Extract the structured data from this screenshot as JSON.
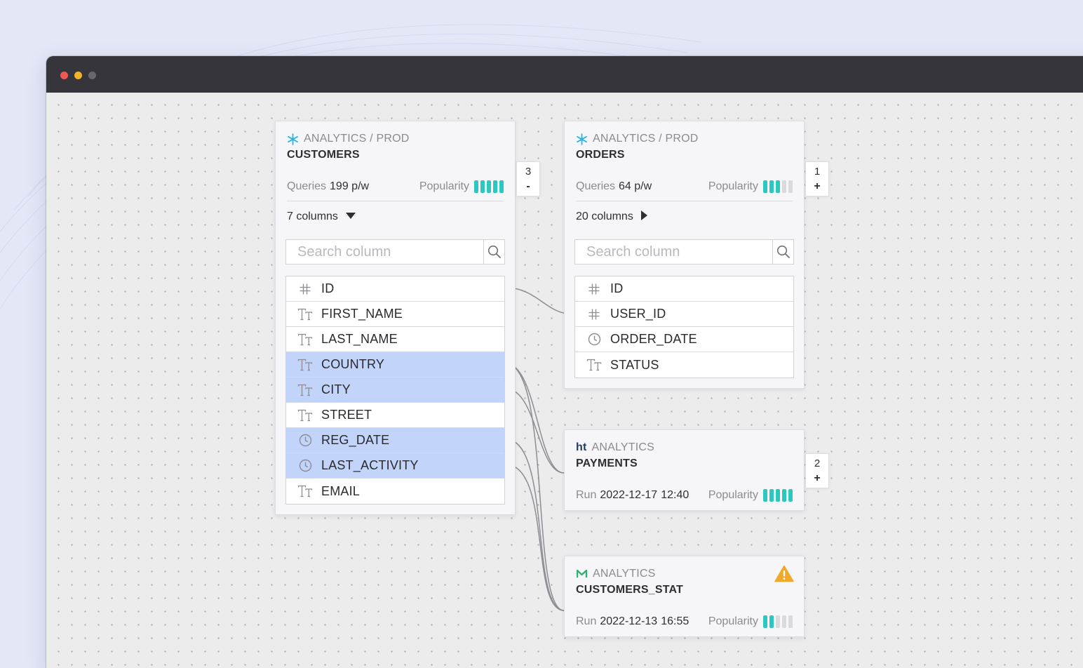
{
  "colors": {
    "accent": "#2cc8c0",
    "selected_row": "#c2d4f9",
    "titlebar": "#36353b",
    "warning": "#f0a92b"
  },
  "customers": {
    "crumb": "ANALYTICS / PROD",
    "icon": "snowflake-icon",
    "name": "CUSTOMERS",
    "queries_label": "Queries",
    "queries_value": "199 p/w",
    "popularity_label": "Popularity",
    "popularity": 5,
    "columns_label": "7 columns",
    "columns_expanded": true,
    "search_placeholder": "Search column",
    "badge_count": "3",
    "badge_toggle": "-",
    "columns": [
      {
        "name": "ID",
        "type": "hash-icon",
        "selected": false
      },
      {
        "name": "FIRST_NAME",
        "type": "text-type-icon",
        "selected": false
      },
      {
        "name": "LAST_NAME",
        "type": "text-type-icon",
        "selected": false
      },
      {
        "name": "COUNTRY",
        "type": "text-type-icon",
        "selected": true
      },
      {
        "name": "CITY",
        "type": "text-type-icon",
        "selected": true
      },
      {
        "name": "STREET",
        "type": "text-type-icon",
        "selected": false
      },
      {
        "name": "REG_DATE",
        "type": "clock-icon",
        "selected": true
      },
      {
        "name": "LAST_ACTIVITY",
        "type": "clock-icon",
        "selected": true
      },
      {
        "name": "EMAIL",
        "type": "text-type-icon",
        "selected": false
      }
    ]
  },
  "orders": {
    "crumb": "ANALYTICS / PROD",
    "icon": "snowflake-icon",
    "name": "ORDERS",
    "queries_label": "Queries",
    "queries_value": "64 p/w",
    "popularity_label": "Popularity",
    "popularity": 3,
    "columns_label": "20 columns",
    "columns_expanded": false,
    "search_placeholder": "Search column",
    "badge_count": "1",
    "badge_toggle": "+",
    "columns": [
      {
        "name": "ID",
        "type": "hash-icon",
        "selected": false
      },
      {
        "name": "USER_ID",
        "type": "hash-icon",
        "selected": false
      },
      {
        "name": "ORDER_DATE",
        "type": "clock-icon",
        "selected": false
      },
      {
        "name": "STATUS",
        "type": "text-type-icon",
        "selected": false
      }
    ]
  },
  "payments": {
    "crumb_prefix": "ht",
    "crumb": "ANALYTICS",
    "icon": "hightouch-icon",
    "name": "PAYMENTS",
    "run_label": "Run",
    "run_date": "2022-12-17",
    "run_time": "12:40",
    "popularity_label": "Popularity",
    "popularity": 5,
    "badge_count": "2",
    "badge_toggle": "+"
  },
  "customers_stat": {
    "crumb": "ANALYTICS",
    "icon": "metabase-icon",
    "name": "CUSTOMERS_STAT",
    "run_label": "Run",
    "run_date": "2022-12-13",
    "run_time": "16:55",
    "popularity_label": "Popularity",
    "popularity": 2,
    "warning_icon": "warning-icon"
  }
}
